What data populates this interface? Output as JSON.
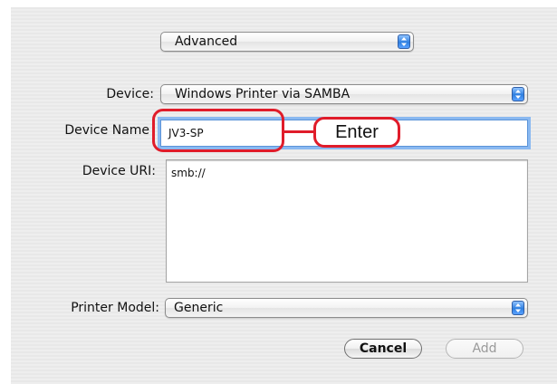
{
  "configuration_popup": {
    "value": "Advanced"
  },
  "device": {
    "label": "Device:",
    "value": "Windows Printer via SAMBA"
  },
  "device_name": {
    "label": "Device Name",
    "value": "JV3-SP"
  },
  "device_uri": {
    "label": "Device URI:",
    "value": "smb://"
  },
  "printer_model": {
    "label": "Printer Model:",
    "value": "Generic"
  },
  "buttons": {
    "cancel": "Cancel",
    "add": "Add"
  },
  "annotation": {
    "text": "Enter"
  },
  "colors": {
    "callout": "#e01c2a",
    "focus_ring": "#8ab9f1",
    "popup_arrows": "#2f7fe0"
  }
}
